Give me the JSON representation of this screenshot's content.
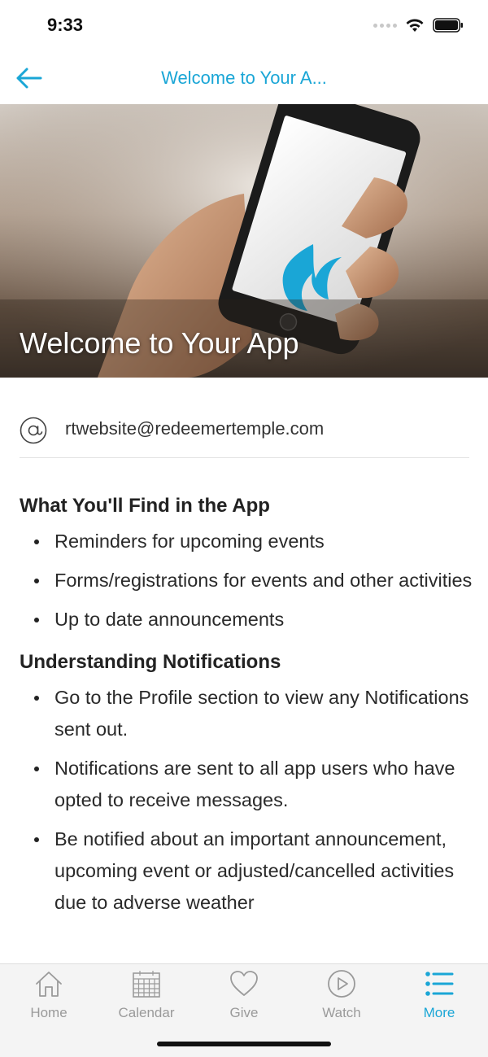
{
  "status": {
    "time": "9:33"
  },
  "nav": {
    "title": "Welcome to Your A..."
  },
  "hero": {
    "title": "Welcome to Your App"
  },
  "contact": {
    "email": "rtwebsite@redeemertemple.com",
    "icon": "at-icon"
  },
  "content": {
    "section1_heading": "What You'll Find in the App",
    "section1_items": [
      "Reminders for upcoming events",
      "Forms/registrations for events and other activities",
      "Up to date announcements"
    ],
    "section2_heading": "Understanding Notifications",
    "section2_items": [
      "Go to the Profile section to view any Notifications sent out.",
      "Notifications are sent to all app users who have opted to receive messages.",
      "Be notified about an important announcement, upcoming event or adjusted/cancelled activities due to adverse weather"
    ]
  },
  "tabs": [
    {
      "label": "Home",
      "icon": "home-icon"
    },
    {
      "label": "Calendar",
      "icon": "calendar-icon"
    },
    {
      "label": "Give",
      "icon": "heart-icon"
    },
    {
      "label": "Watch",
      "icon": "play-icon"
    },
    {
      "label": "More",
      "icon": "list-icon",
      "active": true
    }
  ],
  "colors": {
    "accent": "#1aa6d6",
    "inactive": "#9a9a9a"
  }
}
